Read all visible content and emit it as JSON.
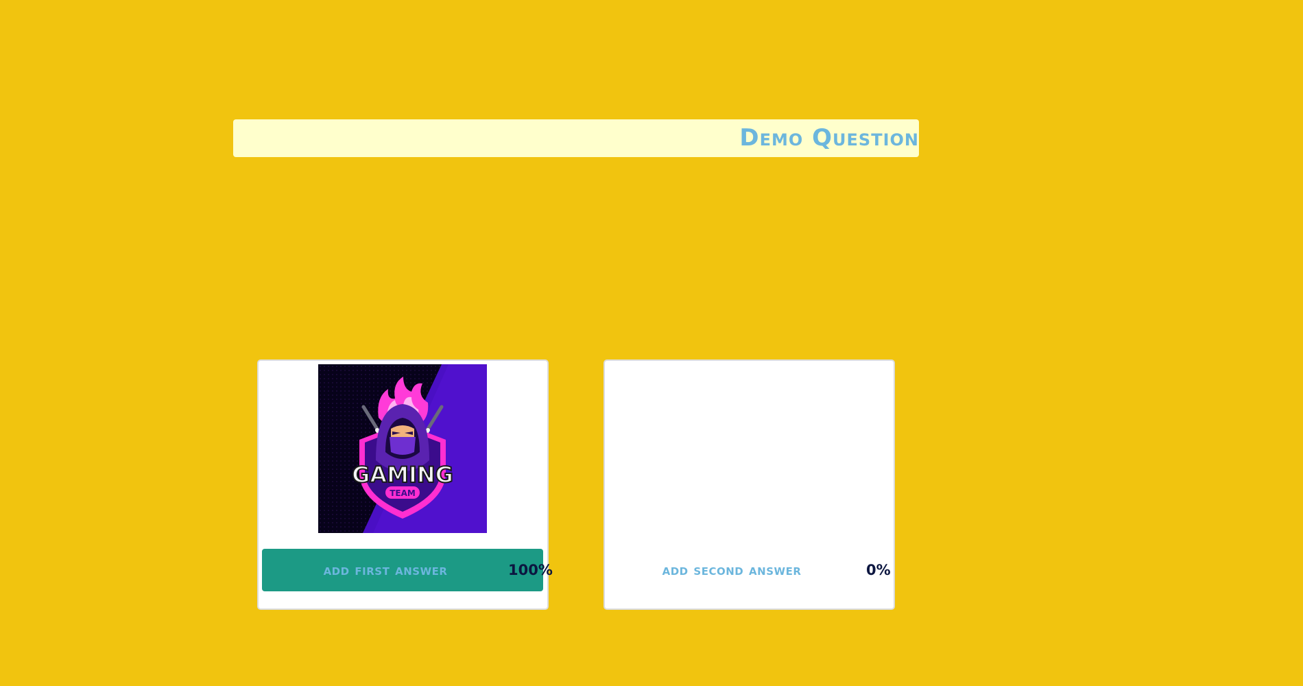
{
  "question": {
    "title": "Demo Question"
  },
  "answers": [
    {
      "label": "add first answer",
      "percent_text": "100%",
      "percent_value": 100,
      "has_image": true,
      "image": {
        "description_icon": "gaming-team-logo",
        "logo_text": "GAMING",
        "logo_subtext": "TEAM"
      }
    },
    {
      "label": "add second answer",
      "percent_text": "0%",
      "percent_value": 0,
      "has_image": false
    }
  ],
  "colors": {
    "background": "#f1c40f",
    "question_bar": "#ffffcc",
    "accent_text": "#6cb6dd",
    "answer_fill": "#1c9a85",
    "percent_text": "#0c1640"
  }
}
